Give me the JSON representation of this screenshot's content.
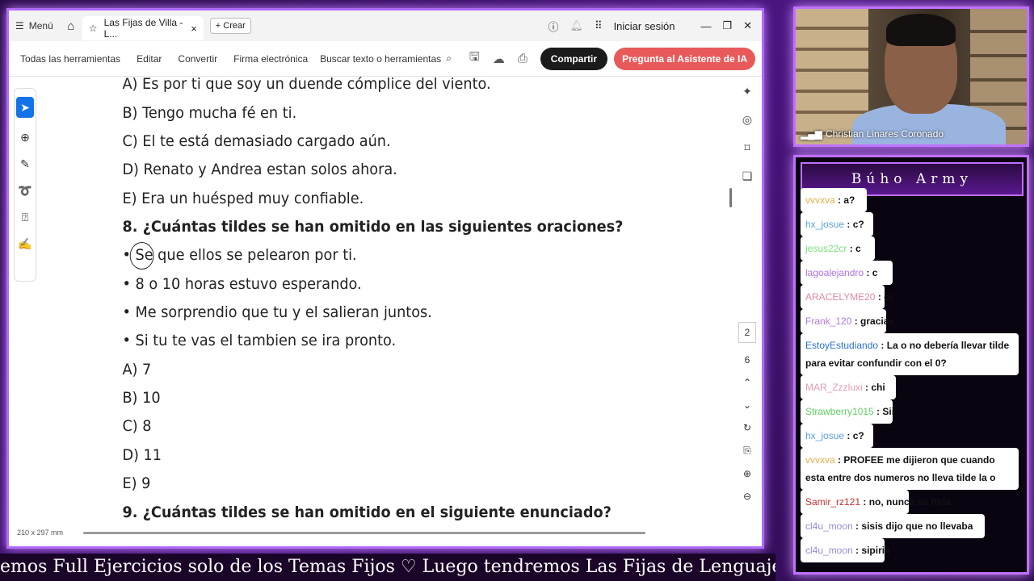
{
  "titlebar": {
    "menu": "Menú",
    "tab_title": "Las Fijas de Villa - L...",
    "create": "Crear",
    "signin": "Iniciar sesión"
  },
  "toolbar": {
    "items": [
      "Todas las herramientas",
      "Editar",
      "Convertir",
      "Firma electrónica"
    ],
    "search": "Buscar texto o herramientas",
    "share": "Compartir",
    "ai": "Pregunta al Asistente de IA"
  },
  "doc": {
    "lines": [
      "A) Es por ti que soy un duende cómplice del viento.",
      "B) Tengo mucha fé en ti.",
      "C) El te está demasiado cargado aún.",
      "D) Renato y Andrea estan solos ahora.",
      "E) Era un huésped muy confiable.",
      "8. ¿Cuántas tildes se han omitido en las siguientes oraciones?",
      "• Se que ellos se pelearon por ti.",
      "• 8 o 10 horas estuvo esperando.",
      "• Me sorprendio que tu y el salieran juntos.",
      "• Si tu te vas el tambien se ira pronto.",
      "A) 7",
      "B) 10",
      "C) 8",
      "D) 11",
      "E) 9",
      "9. ¿Cuántas tildes se han omitido en el siguiente enunciado?"
    ],
    "page_size": "210 x 297 mm",
    "pages": [
      "2",
      "6"
    ]
  },
  "webcam": {
    "name": "Christian Linares Coronado"
  },
  "chat": {
    "title": "Búho Army",
    "messages": [
      {
        "user": "vvvxva",
        "text": "a?",
        "color": "#e8b04a"
      },
      {
        "user": "hx_josue",
        "text": "c?",
        "color": "#5aa0e0"
      },
      {
        "user": "jesus22cr",
        "text": "c",
        "color": "#7ae07a"
      },
      {
        "user": "lagoalejandro",
        "text": "c",
        "color": "#b070e0"
      },
      {
        "user": "ARACELYME20",
        "text": "cc",
        "color": "#e08aa8"
      },
      {
        "user": "Frank_120",
        "text": "gracias",
        "color": "#b07ae0"
      },
      {
        "user": "EstoyEstudiando",
        "text": "La o no debería llevar tilde para evitar confundir con el 0?",
        "color": "#2a70d0"
      },
      {
        "user": "MAR_Zzzluxi",
        "text": "chi",
        "color": "#e0a0b0"
      },
      {
        "user": "Strawberry1015",
        "text": "Sii",
        "color": "#60d060"
      },
      {
        "user": "hx_josue",
        "text": "c?",
        "color": "#5aa0e0"
      },
      {
        "user": "vvvxva",
        "text": "PROFEE me dijieron que cuando esta entre dos numeros no lleva tilde la o",
        "color": "#e8b04a"
      },
      {
        "user": "Samir_rz121",
        "text": "no, nunca se tilda",
        "color": "#c03030"
      },
      {
        "user": "cl4u_moon",
        "text": "sisis dijo que no llevaba",
        "color": "#9a8ad8"
      },
      {
        "user": "cl4u_moon",
        "text": "sipirili",
        "color": "#9a8ad8"
      }
    ]
  },
  "ticker": "emos Full Ejercicios solo de los Temas Fijos   ♡   Luego tendremos Las Fijas de Lenguaje   ♡"
}
